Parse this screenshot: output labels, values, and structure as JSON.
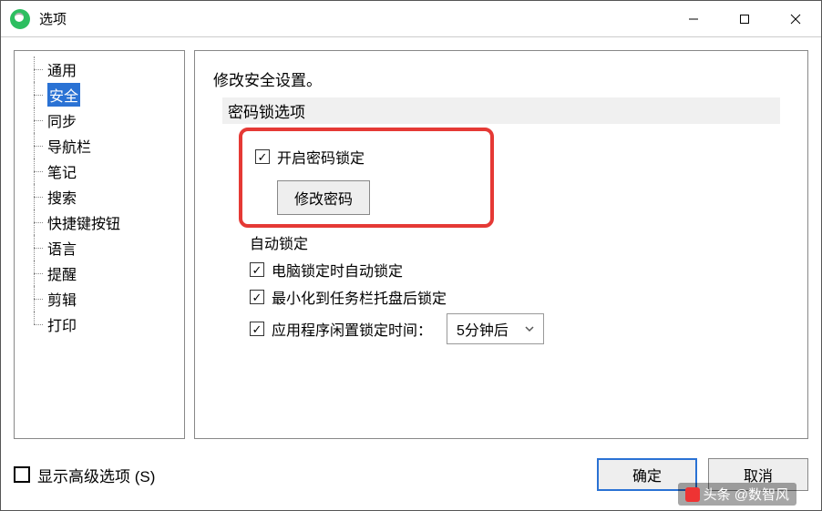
{
  "titlebar": {
    "title": "选项"
  },
  "sidebar": {
    "items": [
      {
        "label": "通用"
      },
      {
        "label": "安全",
        "selected": true
      },
      {
        "label": "同步"
      },
      {
        "label": "导航栏"
      },
      {
        "label": "笔记"
      },
      {
        "label": "搜索"
      },
      {
        "label": "快捷键按钮"
      },
      {
        "label": "语言"
      },
      {
        "label": "提醒"
      },
      {
        "label": "剪辑"
      },
      {
        "label": "打印"
      }
    ]
  },
  "panel": {
    "heading": "修改安全设置。",
    "section_label": "密码锁选项",
    "enable_lock_label": "开启密码锁定",
    "change_pwd_label": "修改密码",
    "auto_lock_heading": "自动锁定",
    "lock_on_pc_lock_label": "电脑锁定时自动锁定",
    "lock_on_minimize_label": "最小化到任务栏托盘后锁定",
    "idle_lock_label": "应用程序闲置锁定时间：",
    "idle_lock_value": "5分钟后"
  },
  "footer": {
    "show_advanced_label": "显示高级选项 (S)",
    "ok_label": "确定",
    "cancel_label": "取消"
  },
  "watermark": {
    "text": "头条 @数智风"
  }
}
